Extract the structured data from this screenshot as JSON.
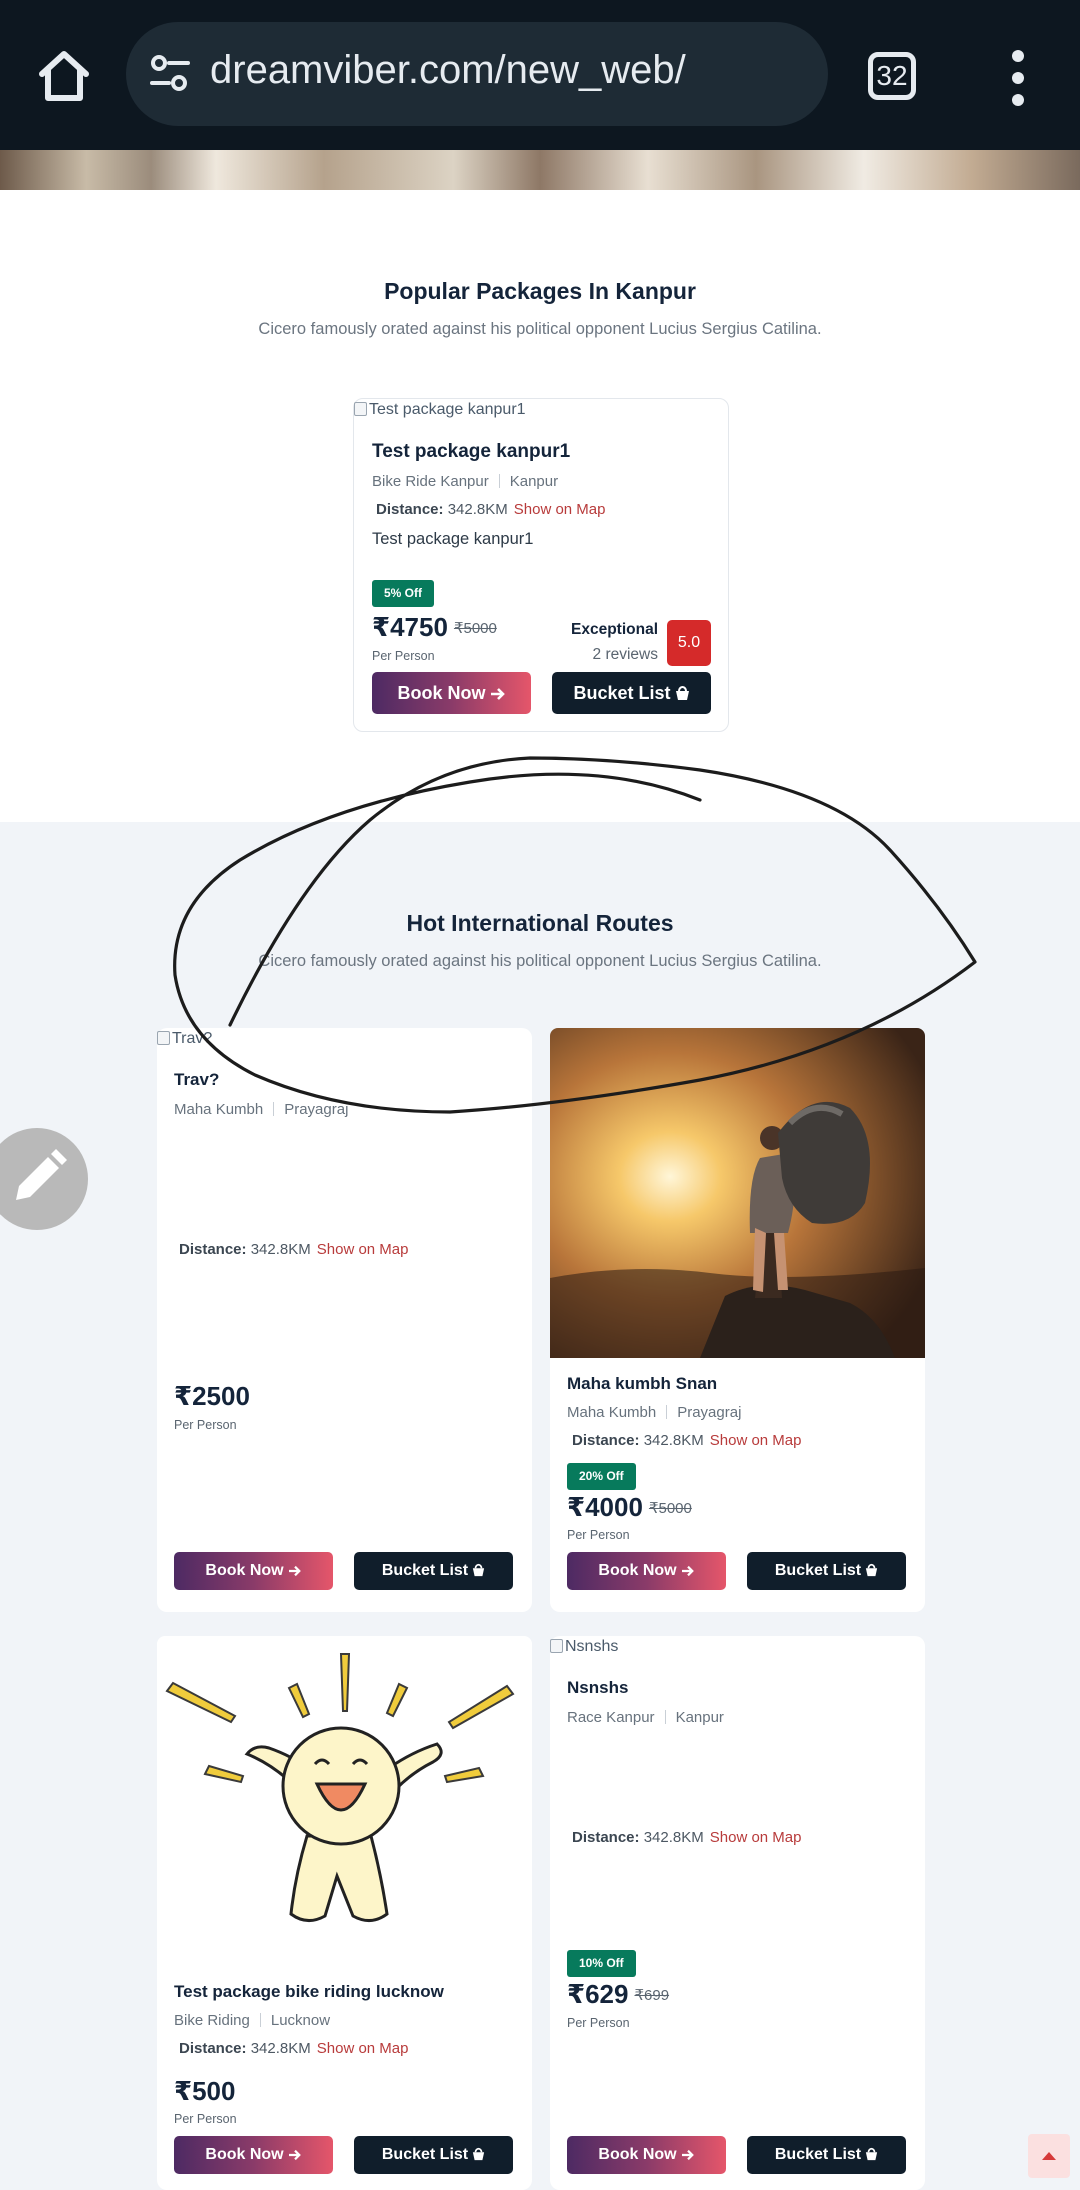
{
  "browser": {
    "url": "dreamviber.com/new_web/",
    "tab_count": "32",
    "icons": [
      "home-icon",
      "site-settings-icon",
      "tabs-icon",
      "more-vert-icon"
    ]
  },
  "popular": {
    "title": "Popular Packages In Kanpur",
    "subtitle": "Cicero famously orated against his political opponent Lucius Sergius Catilina.",
    "card": {
      "image_alt": "Test package kanpur1",
      "title": "Test package kanpur1",
      "category": "Bike Ride Kanpur",
      "location": "Kanpur",
      "distance_label": "Distance:",
      "distance": "342.8KM",
      "map_link": "Show on Map",
      "description": "Test package kanpur1",
      "discount": "5% Off",
      "price": "₹4750",
      "old_price": "₹5000",
      "per": "Per Person",
      "rating_label": "Exceptional",
      "reviews": "2 reviews",
      "score": "5.0",
      "book_label": "Book Now",
      "bucket_label": "Bucket List"
    }
  },
  "hot": {
    "title": "Hot International Routes",
    "subtitle": "Cicero famously orated against his political opponent Lucius Sergius Catilina.",
    "cards": [
      {
        "image_alt": "Trav?",
        "title": "Trav?",
        "category": "Maha Kumbh",
        "location": "Prayagraj",
        "distance_label": "Distance:",
        "distance": "342.8KM",
        "map_link": "Show on Map",
        "price": "₹2500",
        "per": "Per Person",
        "book_label": "Book Now",
        "bucket_label": "Bucket List"
      },
      {
        "image": "hiker-sunset-photo",
        "title": "Maha kumbh Snan",
        "category": "Maha Kumbh",
        "location": "Prayagraj",
        "distance_label": "Distance:",
        "distance": "342.8KM",
        "map_link": "Show on Map",
        "discount": "20% Off",
        "price": "₹4000",
        "old_price": "₹5000",
        "per": "Per Person",
        "book_label": "Book Now",
        "bucket_label": "Bucket List"
      },
      {
        "image": "happy-cartoon-illustration",
        "title": "Test package bike riding lucknow",
        "category": "Bike Riding",
        "location": "Lucknow",
        "distance_label": "Distance:",
        "distance": "342.8KM",
        "map_link": "Show on Map",
        "price": "₹500",
        "per": "Per Person",
        "book_label": "Book Now",
        "bucket_label": "Bucket List"
      },
      {
        "image_alt": "Nsnshs",
        "title": "Nsnshs",
        "category": "Race Kanpur",
        "location": "Kanpur",
        "distance_label": "Distance:",
        "distance": "342.8KM",
        "map_link": "Show on Map",
        "discount": "10% Off",
        "price": "₹629",
        "old_price": "₹699",
        "per": "Per Person",
        "book_label": "Book Now",
        "bucket_label": "Bucket List"
      }
    ]
  },
  "colors": {
    "browser_bar": "#0d1720",
    "book_gradient_start": "#4d2a63",
    "book_gradient_end": "#e5566a",
    "bucket_button": "#101e2b",
    "discount_badge": "#077a5c",
    "rating_box": "#d52a2a",
    "map_link": "#b83b3b"
  }
}
